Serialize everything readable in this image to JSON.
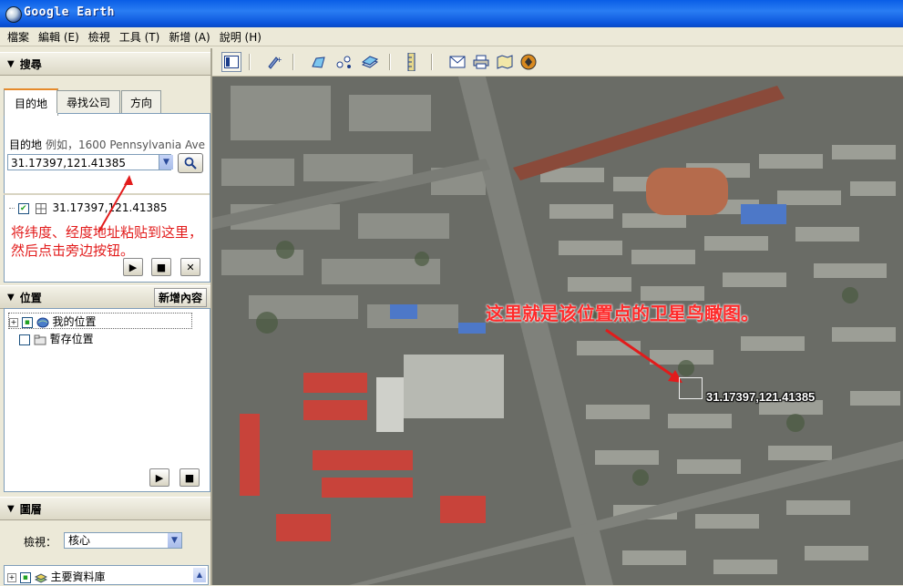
{
  "window": {
    "title": "Google Earth"
  },
  "menu": [
    {
      "label": "檔案"
    },
    {
      "label": "編輯 (E)"
    },
    {
      "label": "檢視"
    },
    {
      "label": "工具 (T)"
    },
    {
      "label": "新增 (A)"
    },
    {
      "label": "說明 (H)"
    }
  ],
  "search_panel": {
    "header": "搜尋",
    "tabs": [
      "目的地",
      "尋找公司",
      "方向"
    ],
    "active_tab": 0,
    "fly_to_label": "目的地",
    "fly_to_hint": "例如，1600 Pennsylvania Ave",
    "input_value": "31.17397,121.41385",
    "result_item": "31.17397,121.41385"
  },
  "annotation_left": "将纬度、经度地址粘贴到这里，然后点击旁边按钮。",
  "places_panel": {
    "header": "位置",
    "add_button": "新增內容",
    "items": [
      {
        "label": "我的位置"
      },
      {
        "label": "暫存位置"
      }
    ]
  },
  "layers_panel": {
    "header": "圖層",
    "view_label": "檢視：",
    "view_value": "核心",
    "items": [
      {
        "label": "主要資料庫"
      }
    ]
  },
  "map": {
    "annotation": "这里就是该位置点的卫星鸟瞰图。",
    "placemark_label": "31.17397,121.41385"
  },
  "colors": {
    "annotation_red": "#e21b1b",
    "titlebar_blue": "#0a5ee6",
    "tab_accent": "#e68b2c"
  }
}
